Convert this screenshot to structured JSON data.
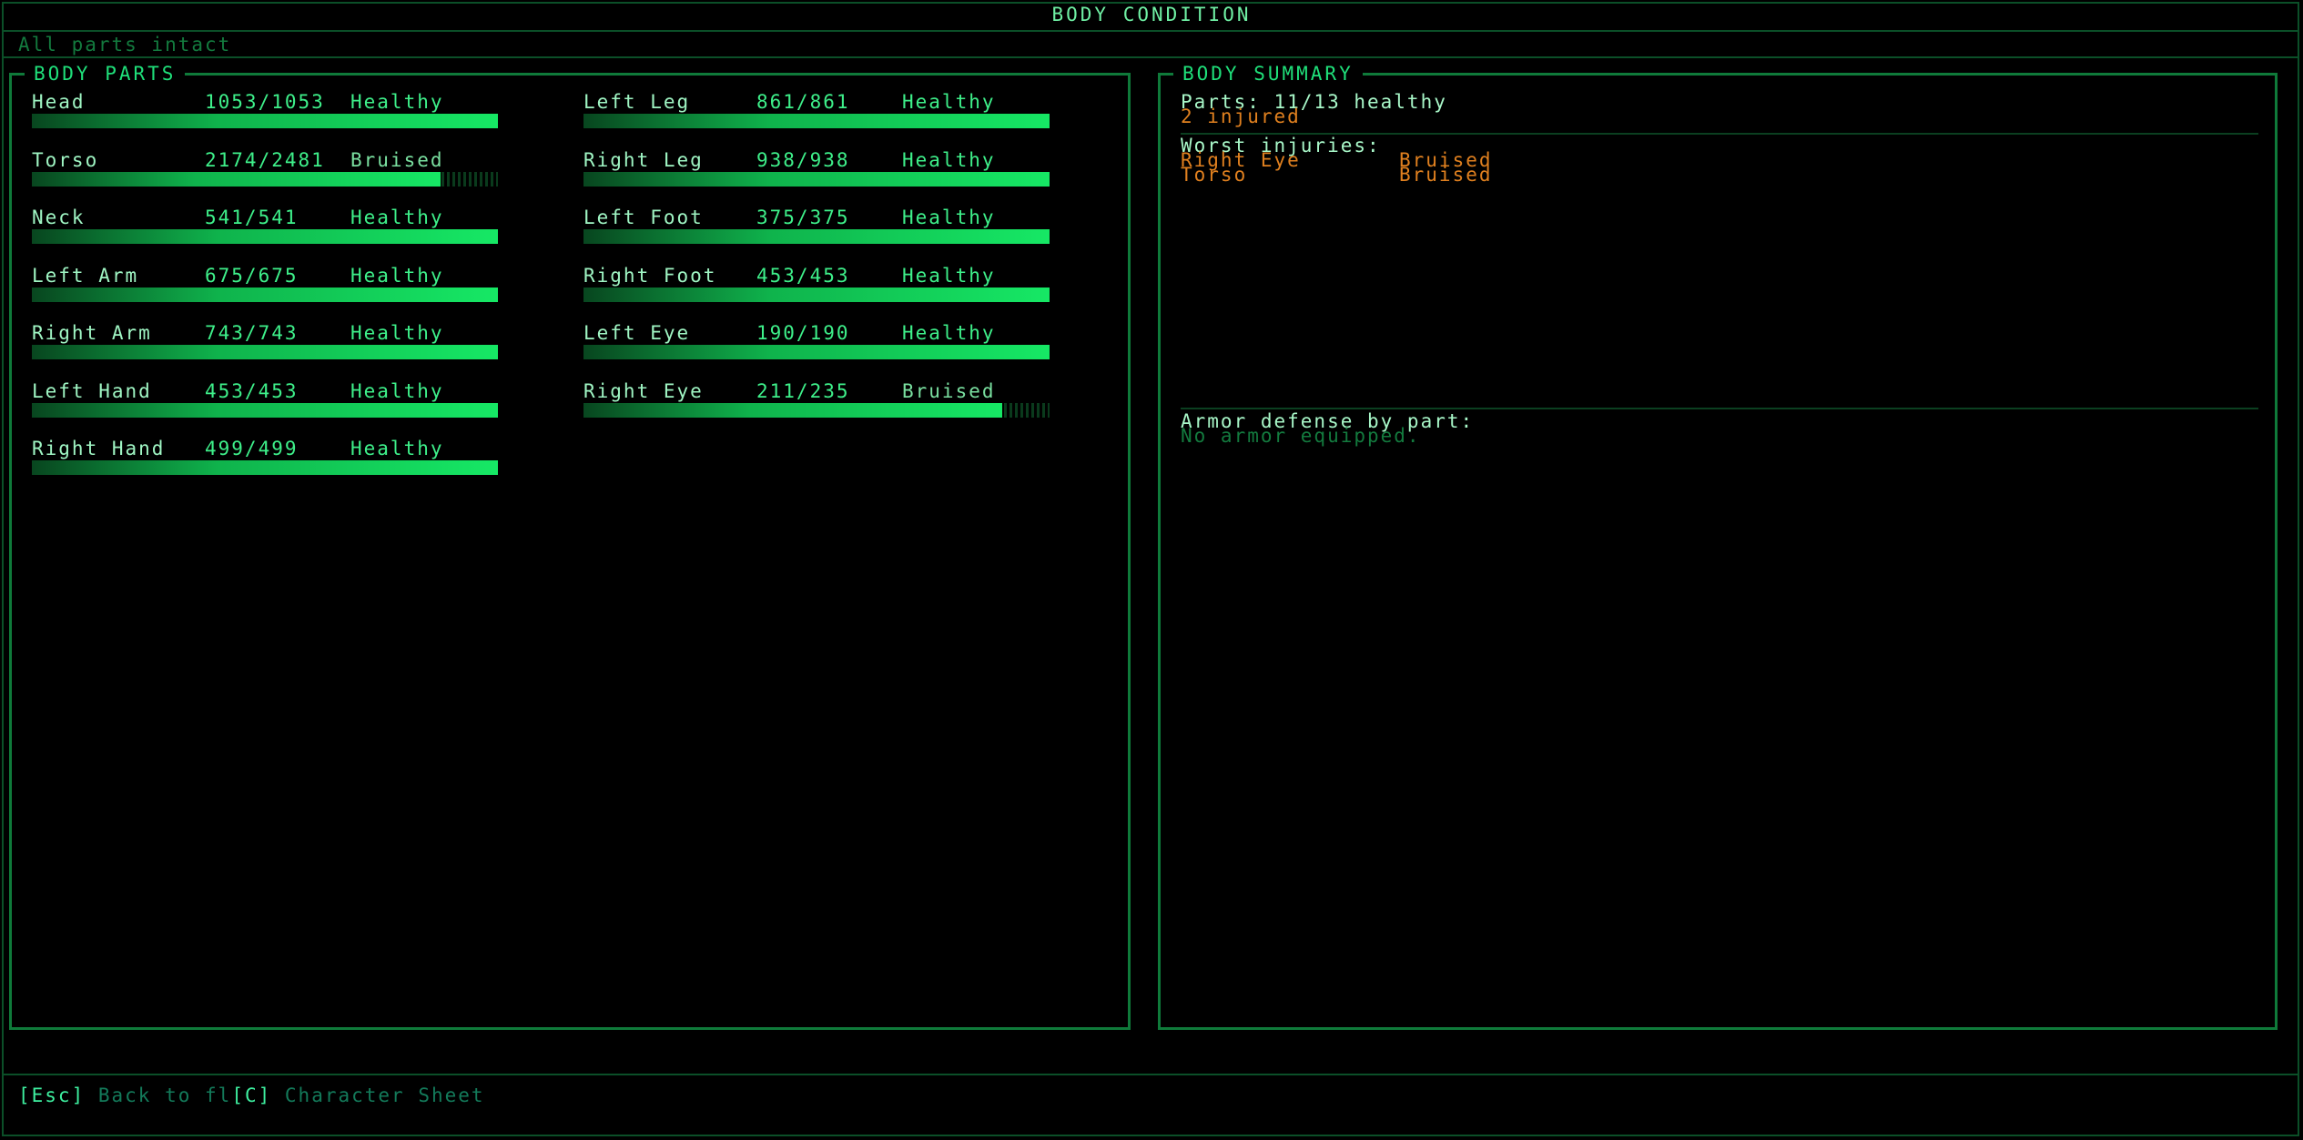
{
  "title": "BODY CONDITION",
  "status_line": "All parts intact",
  "left_panel": {
    "label": "BODY PARTS",
    "parts": [
      {
        "name": "Head",
        "hp": "1053/1053",
        "status": "Healthy",
        "fill": 1.0
      },
      {
        "name": "Torso",
        "hp": "2174/2481",
        "status": "Bruised",
        "fill": 0.876
      },
      {
        "name": "Neck",
        "hp": "541/541",
        "status": "Healthy",
        "fill": 1.0
      },
      {
        "name": "Left Arm",
        "hp": "675/675",
        "status": "Healthy",
        "fill": 1.0
      },
      {
        "name": "Right Arm",
        "hp": "743/743",
        "status": "Healthy",
        "fill": 1.0
      },
      {
        "name": "Left Hand",
        "hp": "453/453",
        "status": "Healthy",
        "fill": 1.0
      },
      {
        "name": "Right Hand",
        "hp": "499/499",
        "status": "Healthy",
        "fill": 1.0
      },
      {
        "name": "Left Leg",
        "hp": "861/861",
        "status": "Healthy",
        "fill": 1.0
      },
      {
        "name": "Right Leg",
        "hp": "938/938",
        "status": "Healthy",
        "fill": 1.0
      },
      {
        "name": "Left Foot",
        "hp": "375/375",
        "status": "Healthy",
        "fill": 1.0
      },
      {
        "name": "Right Foot",
        "hp": "453/453",
        "status": "Healthy",
        "fill": 1.0
      },
      {
        "name": "Left Eye",
        "hp": "190/190",
        "status": "Healthy",
        "fill": 1.0
      },
      {
        "name": "Right Eye",
        "hp": "211/235",
        "status": "Bruised",
        "fill": 0.898
      }
    ]
  },
  "right_panel": {
    "label": "BODY SUMMARY",
    "parts_healthy": "Parts: 11/13 healthy",
    "injured_count": "2 injured",
    "worst_injuries_label": "Worst injuries:",
    "worst_injuries": [
      {
        "part": "Right Eye",
        "status": "Bruised"
      },
      {
        "part": "Torso",
        "status": "Bruised"
      }
    ],
    "armor_label": "Armor defense by part:",
    "armor_value": "No armor equipped."
  },
  "footer": {
    "esc_key": "[Esc]",
    "esc_label": "Back to fl",
    "c_key": "[C]",
    "c_label": "Character Sheet"
  },
  "colors": {
    "bar_fill": "#16e865",
    "border": "#0f7a3a",
    "injury": "#e0801f"
  }
}
